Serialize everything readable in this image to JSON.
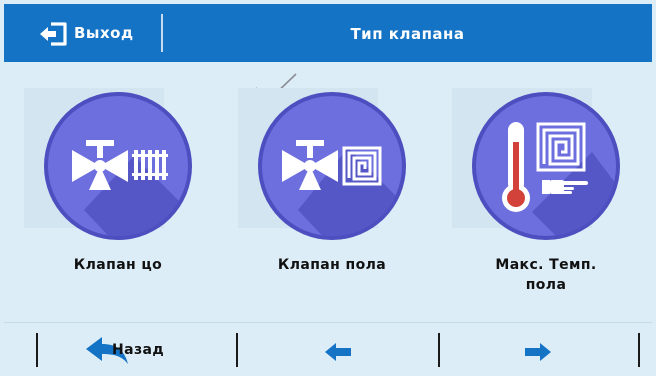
{
  "header": {
    "exit_label": "Выход",
    "title": "Тип клапана"
  },
  "tiles": [
    {
      "label": "Клапан цо",
      "icon": "valve-radiator-icon"
    },
    {
      "label": "Клапан пола",
      "icon": "valve-floor-icon"
    },
    {
      "label_line1": "Макс. Темп.",
      "label_line2": "пола",
      "icon": "thermometer-floor-icon"
    }
  ],
  "nav": {
    "back_label": "Назад"
  },
  "colors": {
    "header": "#1473c4",
    "circle": "#6e6fdf",
    "circle_shadow": "#5557c7",
    "background": "#dcedf7"
  }
}
